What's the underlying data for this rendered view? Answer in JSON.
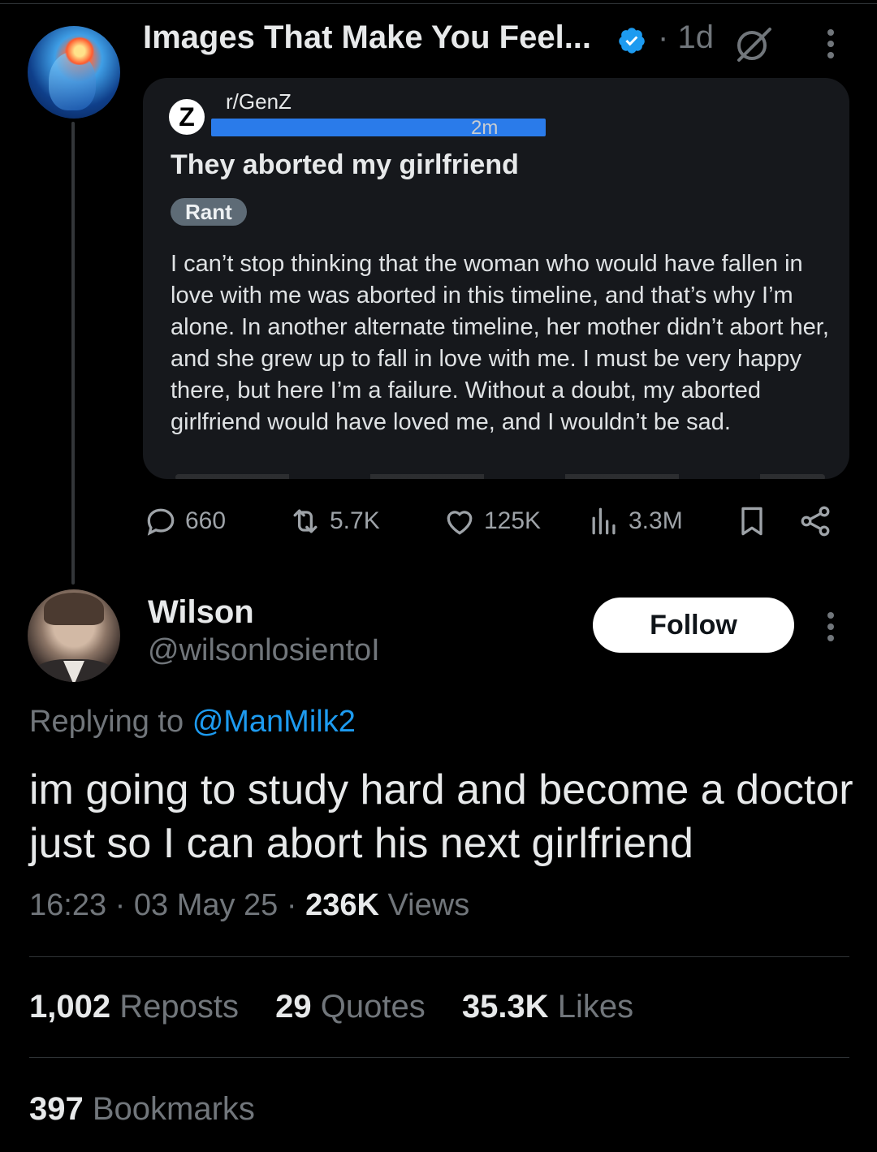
{
  "parent_tweet": {
    "author_name": "Images That Make You Feel...",
    "time_prefix": "·",
    "time": "1d",
    "embedded_post": {
      "subreddit_logo": "Z",
      "subreddit": "r/GenZ",
      "age": "2m",
      "title": "They aborted my girlfriend",
      "flair": "Rant",
      "body": "I can’t stop thinking that the woman who would have fallen in love with me was aborted in this timeline, and that’s why I’m alone. In another alternate timeline, her mother didn’t abort her, and she grew up to fall in love with me. I must be very happy there, but here I’m a failure. Without a doubt, my aborted girlfriend would have loved me, and I wouldn’t be sad."
    },
    "actions": {
      "replies": "660",
      "reposts": "5.7K",
      "likes": "125K",
      "views": "3.3M"
    }
  },
  "reply": {
    "author_name": "Wilson",
    "handle": "@wilsonlosientoI",
    "follow_label": "Follow",
    "replying_prefix": "Replying to",
    "replying_handle": "@ManMilk2",
    "text": "im going to study hard and become a doctor just so I can abort his next girlfriend",
    "time": "16:23",
    "sep1": "·",
    "date": "03 May 25",
    "sep2": "·",
    "views_count": "236K",
    "views_label": "Views",
    "reposts_count": "1,002",
    "reposts_label": "Reposts",
    "quotes_count": "29",
    "quotes_label": "Quotes",
    "likes_count": "35.3K",
    "likes_label": "Likes",
    "bookmarks_count": "397",
    "bookmarks_label": "Bookmarks"
  },
  "colors": {
    "background": "#000000",
    "text_primary": "#e7e9ea",
    "text_secondary": "#71767b",
    "link": "#1d9bf0",
    "card": "#16181c",
    "follow_button": "#ffffff"
  },
  "icons": [
    "verified-badge-icon",
    "grok-icon",
    "more-icon",
    "reply-icon",
    "repost-icon",
    "like-icon",
    "views-icon",
    "bookmark-icon",
    "share-icon"
  ]
}
